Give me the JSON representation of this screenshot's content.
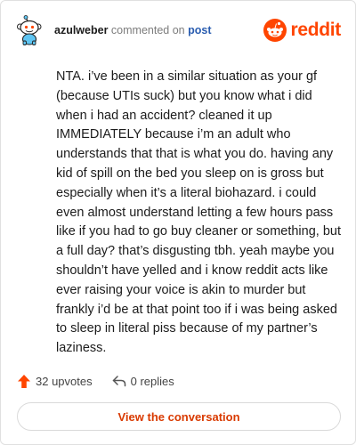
{
  "header": {
    "username": "azulweber",
    "verb": "commented on",
    "post_link": "post",
    "brand": "reddit"
  },
  "comment": {
    "text": "NTA. i’ve been in a similar situation as your gf (because UTIs suck) but you know what i did when i had an accident? cleaned it up IMMEDIATELY because i’m an adult who understands that that is what you do. having any kid of spill on the bed you sleep on is gross but especially when it’s a literal biohazard. i could even almost understand letting a few hours pass like if you had to go buy cleaner or something, but a full day? that’s disgusting tbh. yeah maybe you shouldn’t have yelled and i know reddit acts like ever raising your voice is akin to murder but frankly i’d be at that point too if i was being asked to sleep in literal piss because of my partner’s laziness."
  },
  "actions": {
    "upvotes": "32 upvotes",
    "replies": "0 replies"
  },
  "cta": {
    "label": "View the conversation"
  },
  "colors": {
    "brand": "#ff4500",
    "link": "#2a5db0",
    "cta_text": "#d93a00",
    "snoo_avatar": "#5fc5f2"
  },
  "icons": {
    "avatar": "snoo-avatar-icon",
    "brand": "reddit-logo-icon",
    "upvote": "upvote-arrow-icon",
    "reply": "reply-arrow-icon"
  }
}
